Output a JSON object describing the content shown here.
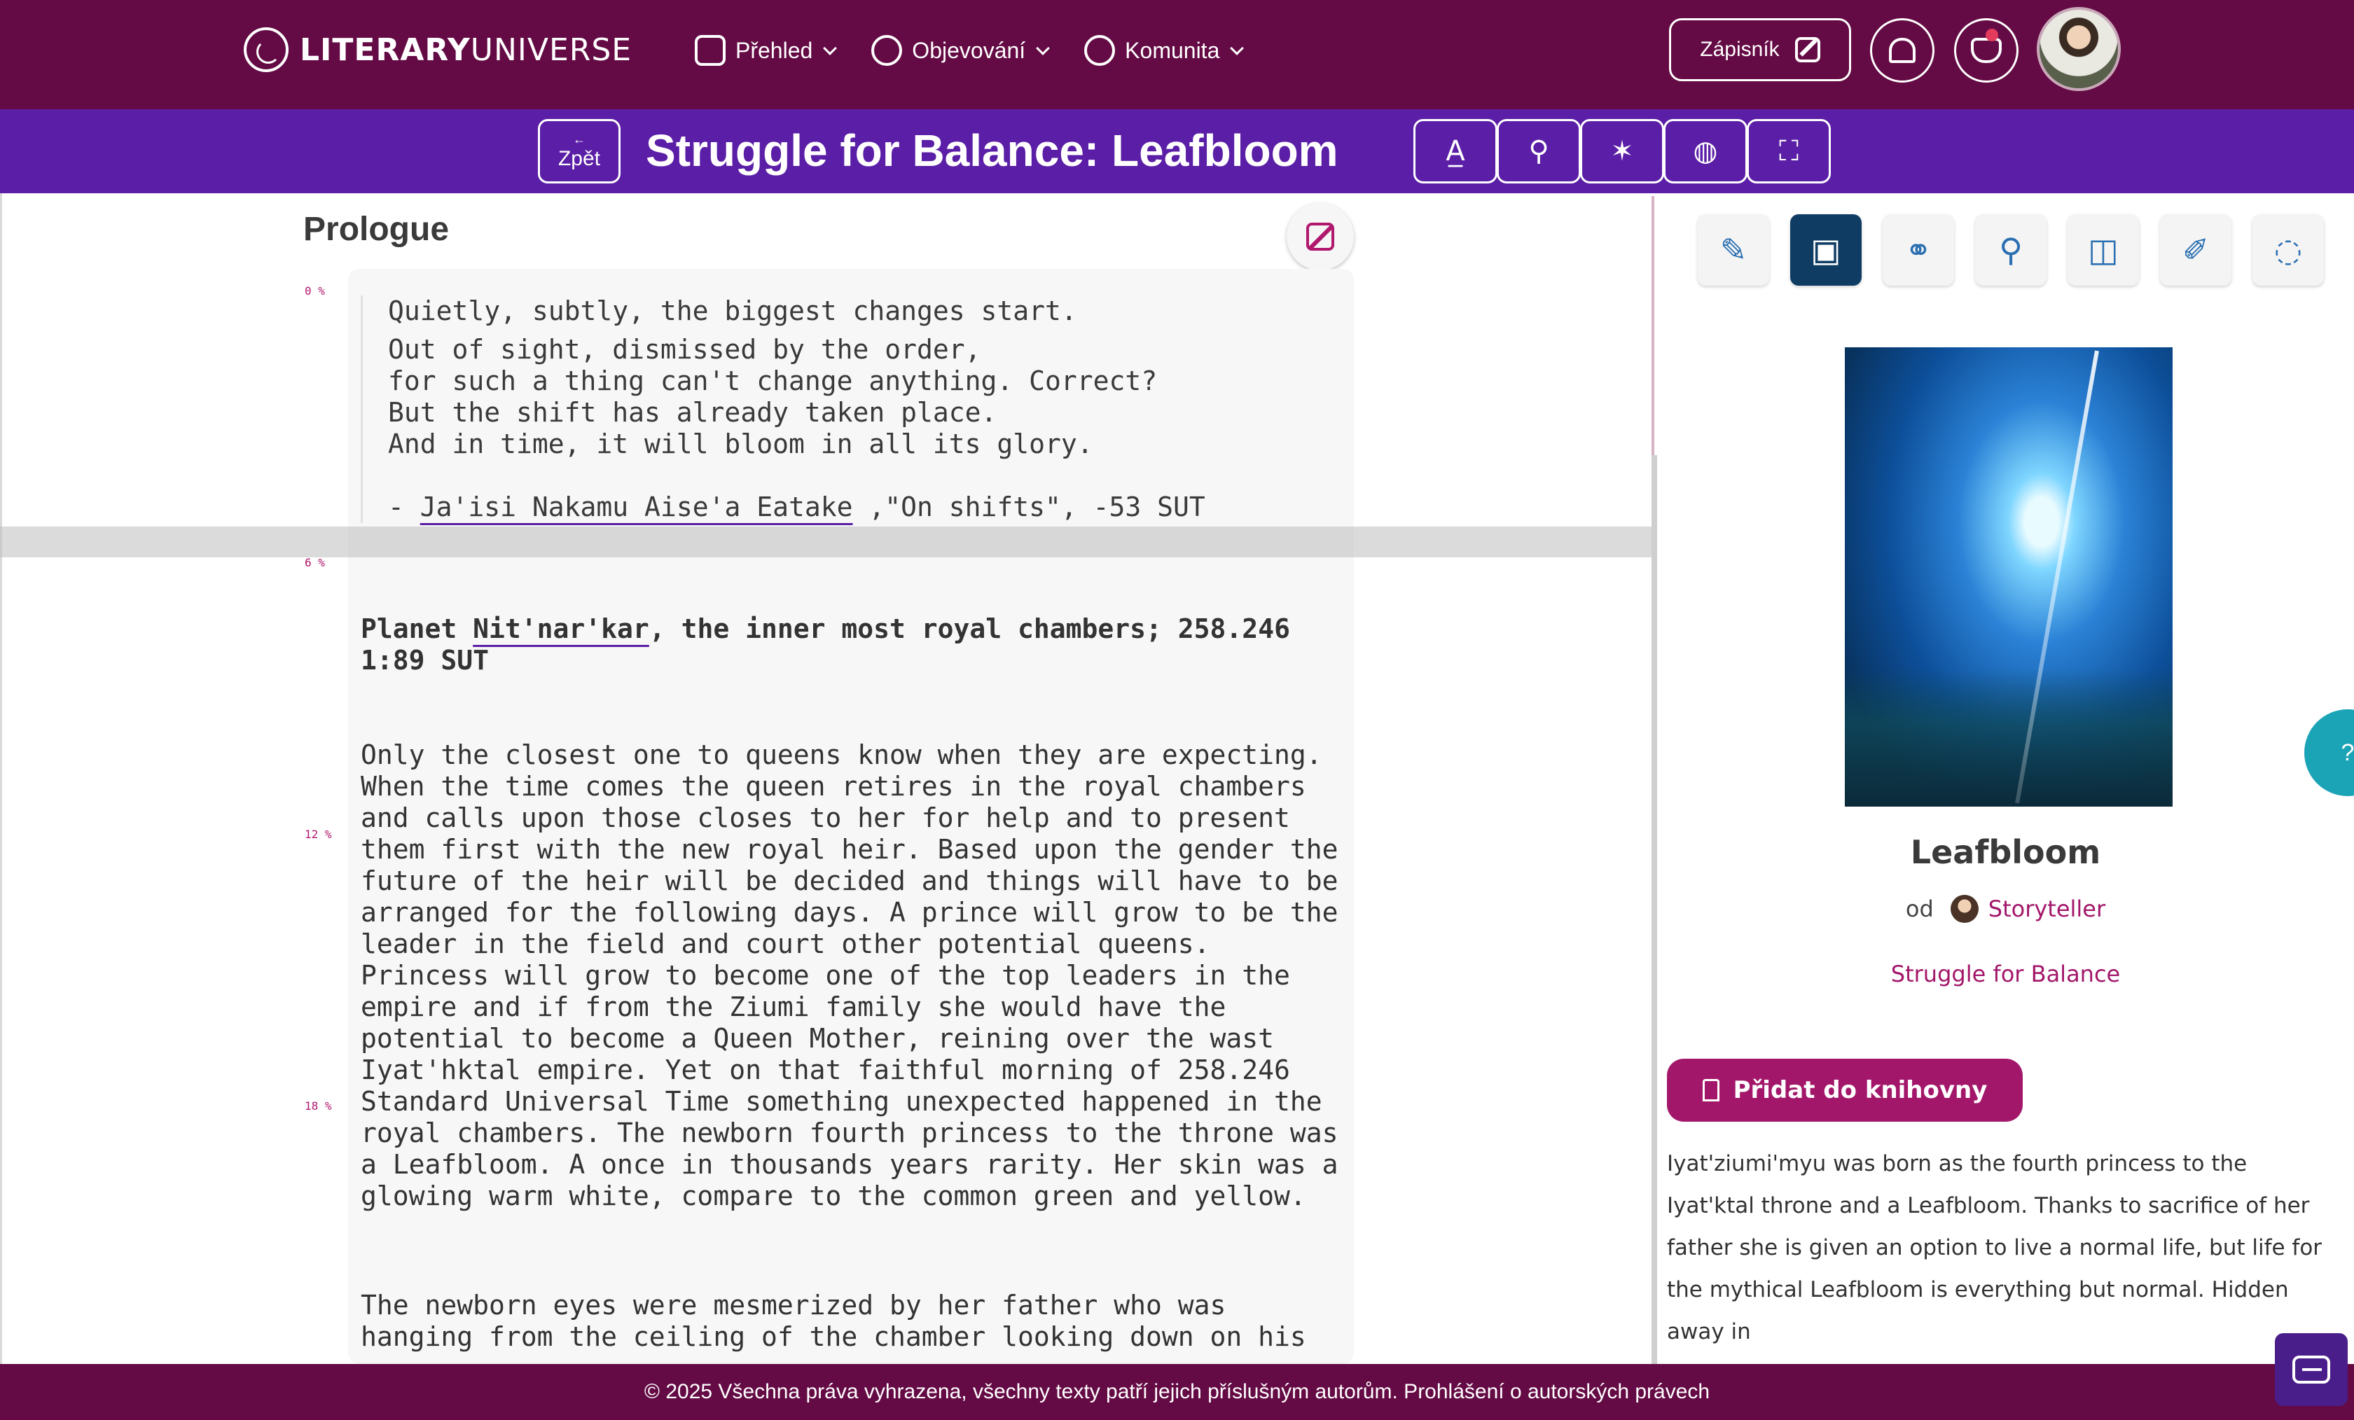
{
  "nav": {
    "logo_bold": "LITERARY",
    "logo_thin": "UNIVERSE",
    "menu": [
      {
        "label": "Přehled",
        "icon": "grid-icon"
      },
      {
        "label": "Objevování",
        "icon": "compass-icon"
      },
      {
        "label": "Komunita",
        "icon": "people-icon"
      }
    ],
    "notebook_label": "Zápisník"
  },
  "titlebar": {
    "back_label": "Zpět",
    "back_arrow": "←",
    "title": "Struggle for Balance: Leafbloom",
    "tools": [
      {
        "name": "font-settings-icon",
        "glyph": "A̲"
      },
      {
        "name": "location-pin-icon",
        "glyph": "⚲"
      },
      {
        "name": "character-icon",
        "glyph": "✶"
      },
      {
        "name": "globe-icon",
        "glyph": "◍"
      },
      {
        "name": "fullscreen-icon",
        "glyph": "⛶"
      }
    ]
  },
  "reader": {
    "chapter_title": "Prologue",
    "progress_marks": [
      "0 %",
      "6 %",
      "12 %",
      "18 %"
    ],
    "quote_lines": [
      "Quietly, subtly, the biggest changes start.",
      "Out of sight, dismissed by the order,",
      "for such a thing can't change anything. Correct?",
      "But the shift has already taken place.",
      "And in time, it will bloom in all its glory."
    ],
    "quote_dash": "- ",
    "quote_author": "Ja'isi Nakamu Aise'a Eatake",
    "quote_source": " ,\"On shifts\", -53 SUT",
    "heading_pre": "Planet ",
    "heading_link": "Nit'nar'kar",
    "heading_post": ", the inner most royal chambers; 258.246",
    "heading_line2": "1:89 SUT",
    "paragraph1": "Only the closest one to queens know when they are expecting. When the time comes the queen retires in the royal chambers and calls upon those closes to her for help and to present them first with the new royal heir. Based upon the gender the future of the heir will be decided and things will have to be arranged for the following days. A prince will grow to be the leader in the field and court other potential queens. Princess will grow to become one of the top leaders in the empire and if from the Ziumi family she would have the potential to become a Queen Mother, reining over the wast Iyat'hktal empire. Yet on that faithful morning of 258.246 Standard Universal Time something unexpected happened in the royal chambers. The newborn fourth princess to the throne was a Leafbloom. A once in thousands years rarity. Her skin was a glowing warm white, compare to the common green and yellow.",
    "paragraph2": "The newborn eyes were mesmerized by her father who was hanging from the ceiling of the chamber looking down on his"
  },
  "sidebar": {
    "tools": [
      {
        "name": "write-icon",
        "glyph": "✎",
        "active": false
      },
      {
        "name": "book-info-icon",
        "glyph": "▣",
        "active": true
      },
      {
        "name": "link-icon",
        "glyph": "⚭",
        "active": false
      },
      {
        "name": "search-icon",
        "glyph": "⚲",
        "active": false
      },
      {
        "name": "library-icon",
        "glyph": "◫",
        "active": false
      },
      {
        "name": "edit-icon",
        "glyph": "✐",
        "active": false
      },
      {
        "name": "comment-icon",
        "glyph": "◌",
        "active": false
      }
    ],
    "book_name": "Leafbloom",
    "by_label": "od",
    "author": "Storyteller",
    "series": "Struggle for Balance",
    "add_library": "Přidat do knihovny",
    "synopsis": "Iyat'ziumi'myu was born as the fourth princess to the Iyat'ktal throne and a Leafbloom. Thanks to sacrifice of her father she is given an option to live a normal life, but life for the mythical Leafbloom is everything but normal. Hidden away in"
  },
  "help_label": "?",
  "footer": {
    "text": "© 2025 Všechna práva vyhrazena, všechny texty patří jejich příslušným autorům. Prohlášení o autorských právech"
  },
  "colors": {
    "nav_bg": "#640a44",
    "titlebar_bg": "#5b1ea6",
    "accent": "#a3176a",
    "active_tool": "#0f3c63",
    "help_fab": "#1ba3b6"
  }
}
